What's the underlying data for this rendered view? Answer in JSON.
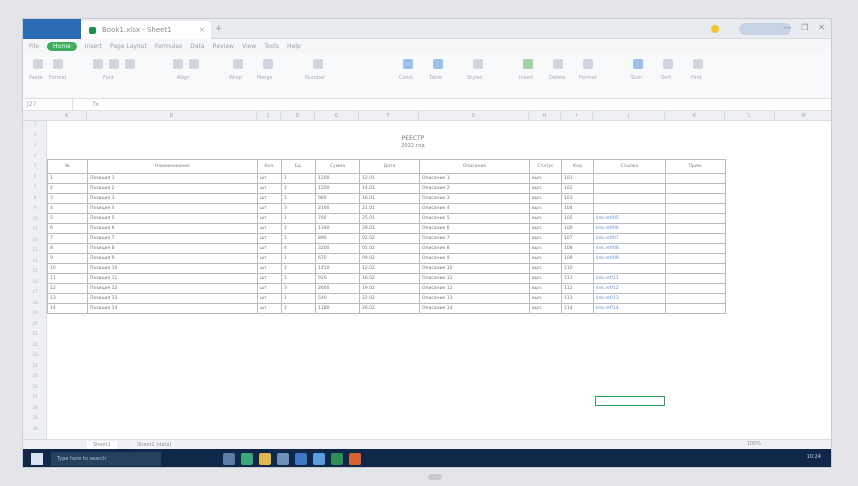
{
  "window": {
    "doc_tab_title": "Book1.xlsx - Sheet1",
    "tab_close": "×",
    "new_tab": "+",
    "window_controls": [
      "—",
      "❐",
      "✕"
    ]
  },
  "menu": {
    "items": [
      "File",
      "Home",
      "Insert",
      "Page Layout",
      "Formulas",
      "Data",
      "Review",
      "View",
      "Tools",
      "Help"
    ],
    "active_index": 1
  },
  "ribbon": {
    "group_labels": [
      "Paste",
      "Format",
      "Font",
      "Align",
      "Wrap",
      "Merge",
      "Number",
      "Cond.",
      "Table",
      "Styles",
      "Insert",
      "Delete",
      "Format",
      "Sum",
      "Sort",
      "Find"
    ]
  },
  "formula_bar": {
    "name_box": "J27",
    "fx": "fx"
  },
  "columns": [
    "A",
    "B",
    "C",
    "D",
    "E",
    "F",
    "G",
    "H",
    "I",
    "J",
    "K",
    "L",
    "M"
  ],
  "sheet": {
    "title": "РЕЕСТР",
    "subtitle": "2022 год",
    "headers": [
      "№",
      "Наименование",
      "Кол.",
      "Ед.",
      "Сумма",
      "Дата",
      "Описание",
      "Статус",
      "Код",
      "Ссылка",
      "Прим."
    ],
    "rows": [
      [
        "1",
        "Позиция 1",
        "шт",
        "1",
        "1200",
        "12.01",
        "Описание 1",
        "вып.",
        "101",
        "",
        ""
      ],
      [
        "2",
        "Позиция 2",
        "шт",
        "2",
        "1500",
        "14.01",
        "Описание 2",
        "вып.",
        "102",
        "",
        ""
      ],
      [
        "3",
        "Позиция 3",
        "шт",
        "1",
        "980",
        "18.01",
        "Описание 3",
        "вып.",
        "103",
        "",
        ""
      ],
      [
        "4",
        "Позиция 4",
        "шт",
        "3",
        "2100",
        "21.01",
        "Описание 4",
        "вып.",
        "104",
        "",
        ""
      ],
      [
        "5",
        "Позиция 5",
        "шт",
        "1",
        "760",
        "25.01",
        "Описание 5",
        "вып.",
        "105",
        "link.ref/05",
        ""
      ],
      [
        "6",
        "Позиция 6",
        "шт",
        "2",
        "1340",
        "28.01",
        "Описание 6",
        "вып.",
        "106",
        "link.ref/06",
        ""
      ],
      [
        "7",
        "Позиция 7",
        "шт",
        "1",
        "890",
        "02.02",
        "Описание 7",
        "вып.",
        "107",
        "link.ref/07",
        ""
      ],
      [
        "8",
        "Позиция 8",
        "шт",
        "4",
        "3200",
        "05.02",
        "Описание 8",
        "вып.",
        "108",
        "link.ref/08",
        ""
      ],
      [
        "9",
        "Позиция 9",
        "шт",
        "1",
        "670",
        "09.02",
        "Описание 9",
        "вып.",
        "109",
        "link.ref/09",
        ""
      ],
      [
        "10",
        "Позиция 10",
        "шт",
        "2",
        "1450",
        "12.02",
        "Описание 10",
        "вып.",
        "110",
        "",
        ""
      ],
      [
        "11",
        "Позиция 11",
        "шт",
        "1",
        "920",
        "16.02",
        "Описание 11",
        "вып.",
        "111",
        "link.ref/11",
        ""
      ],
      [
        "12",
        "Позиция 12",
        "шт",
        "3",
        "2600",
        "19.02",
        "Описание 12",
        "вып.",
        "112",
        "link.ref/12",
        ""
      ],
      [
        "13",
        "Позиция 13",
        "шт",
        "1",
        "540",
        "22.02",
        "Описание 13",
        "вып.",
        "113",
        "link.ref/13",
        ""
      ],
      [
        "14",
        "Позиция 14",
        "шт",
        "2",
        "1180",
        "26.02",
        "Описание 14",
        "вып.",
        "114",
        "link.ref/14",
        ""
      ]
    ]
  },
  "sheet_tabs": [
    "Sheet1",
    "Sheet2 (data)"
  ],
  "status_bar": {
    "zoom": "100%"
  },
  "taskbar": {
    "search_placeholder": "Type here to search",
    "tray_time": "10:24"
  },
  "colors": {
    "accent": "#3fae5c",
    "taskbar": "#0f2748",
    "link": "#5f8fd0",
    "selection": "#27a159"
  }
}
